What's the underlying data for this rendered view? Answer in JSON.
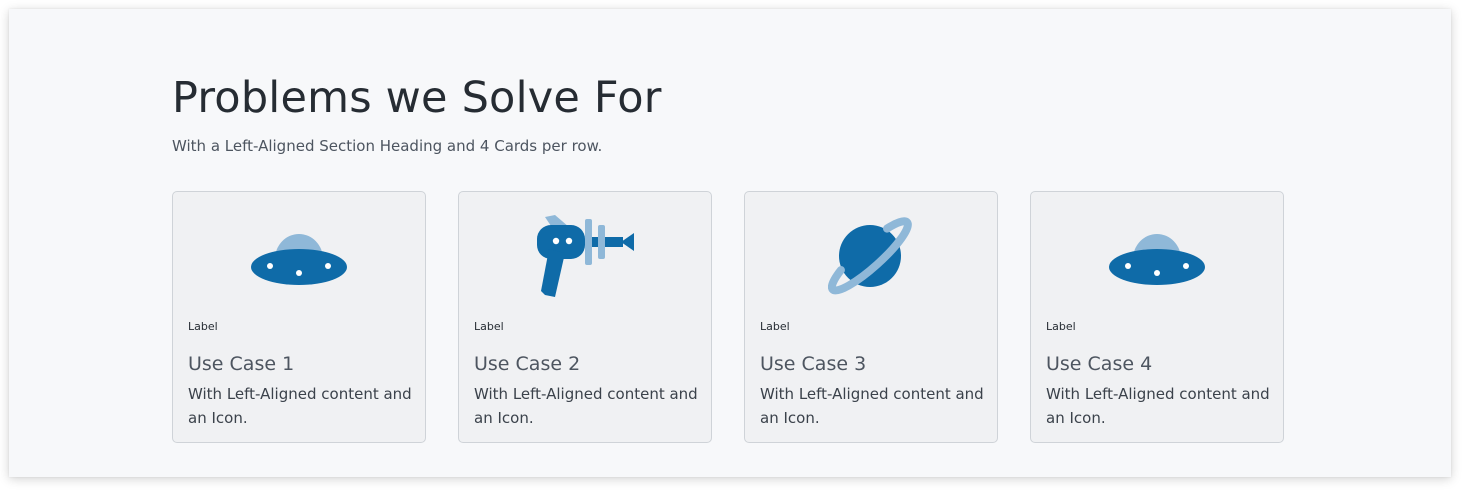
{
  "section": {
    "title": "Problems we Solve For",
    "subtitle": "With a Left-Aligned Section Heading and 4 Cards per row."
  },
  "cards": [
    {
      "icon": "ufo-icon",
      "label": "Label",
      "title": "Use Case 1",
      "description": "With Left-Aligned content and an Icon."
    },
    {
      "icon": "ray-gun-icon",
      "label": "Label",
      "title": "Use Case 2",
      "description": "With Left-Aligned content and an Icon."
    },
    {
      "icon": "planet-icon",
      "label": "Label",
      "title": "Use Case 3",
      "description": "With Left-Aligned content and an Icon."
    },
    {
      "icon": "ufo-icon",
      "label": "Label",
      "title": "Use Case 4",
      "description": "With Left-Aligned content and an Icon."
    }
  ],
  "colors": {
    "icon_primary": "#0f6ba8",
    "icon_secondary": "#8fb8d8",
    "background": "#f7f8fa",
    "card_background": "#f0f1f3",
    "heading_text": "#262c33"
  }
}
